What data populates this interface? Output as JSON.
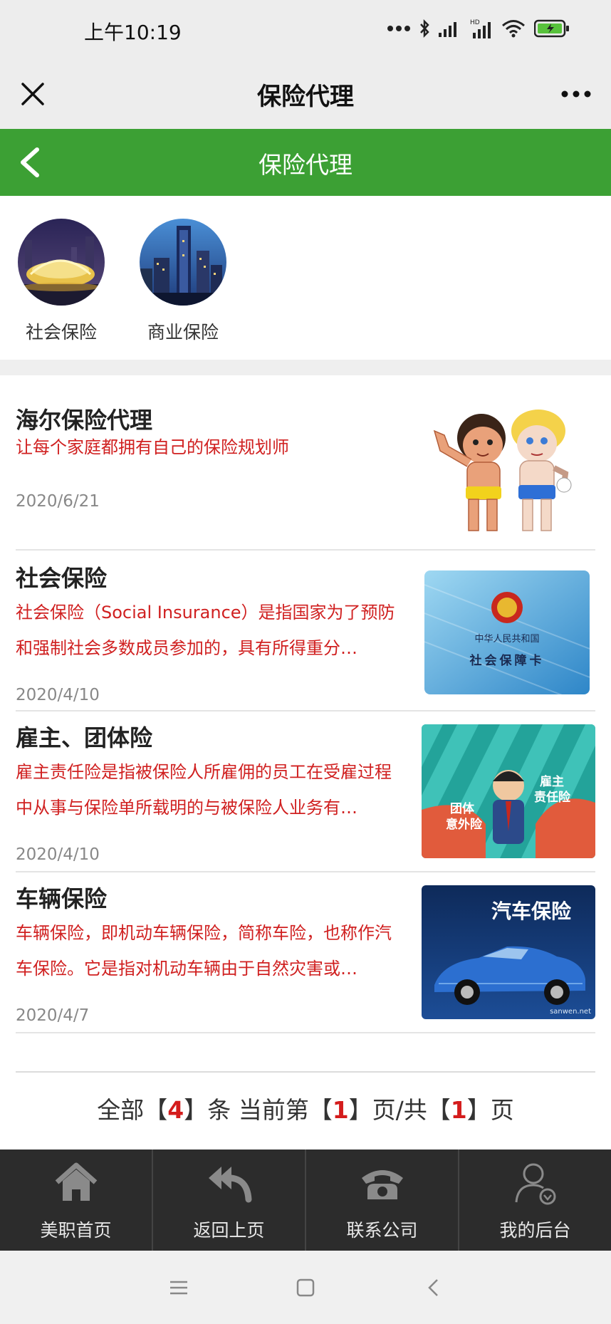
{
  "status_bar": {
    "time": "上午10:19"
  },
  "wechat_bar": {
    "title": "保险代理"
  },
  "header": {
    "title": "保险代理",
    "accent": "#3ca034"
  },
  "categories": [
    {
      "label": "社会保险"
    },
    {
      "label": "商业保险"
    }
  ],
  "articles": [
    {
      "title": "海尔保险代理",
      "desc": "让每个家庭都拥有自己的保险规划师",
      "date": "2020/6/21"
    },
    {
      "title": "社会保险",
      "desc": "社会保险（Social Insurance）是指国家为了预防和强制社会多数成员参加的，具有所得重分…",
      "date": "2020/4/10",
      "image_text": [
        "中华人民共和国",
        "社会保障卡"
      ]
    },
    {
      "title": "雇主、团体险",
      "desc": "雇主责任险是指被保险人所雇佣的员工在受雇过程中从事与保险单所载明的与被保险人业务有…",
      "date": "2020/4/10",
      "image_text": [
        "团体",
        "意外险",
        "雇主",
        "责任险"
      ]
    },
    {
      "title": "车辆保险",
      "desc": "车辆保险，即机动车辆保险，简称车险，也称作汽车保险。它是指对机动车辆由于自然灾害或…",
      "date": "2020/4/7",
      "image_text": [
        "汽车保险",
        "sanwen.net"
      ]
    }
  ],
  "pager": {
    "prefix": "全部【",
    "total": "4",
    "mid1": "】条 当前第【",
    "current": "1",
    "mid2": "】页/共【",
    "pages": "1",
    "suffix": "】页"
  },
  "bottom_nav": [
    {
      "label": "美职首页",
      "icon": "home-icon"
    },
    {
      "label": "返回上页",
      "icon": "reply-icon"
    },
    {
      "label": "联系公司",
      "icon": "phone-icon"
    },
    {
      "label": "我的后台",
      "icon": "user-icon"
    }
  ],
  "colors": {
    "desc_red": "#d02020",
    "nav_bg": "#2c2c2c",
    "pager_red": "#d41c1c"
  }
}
